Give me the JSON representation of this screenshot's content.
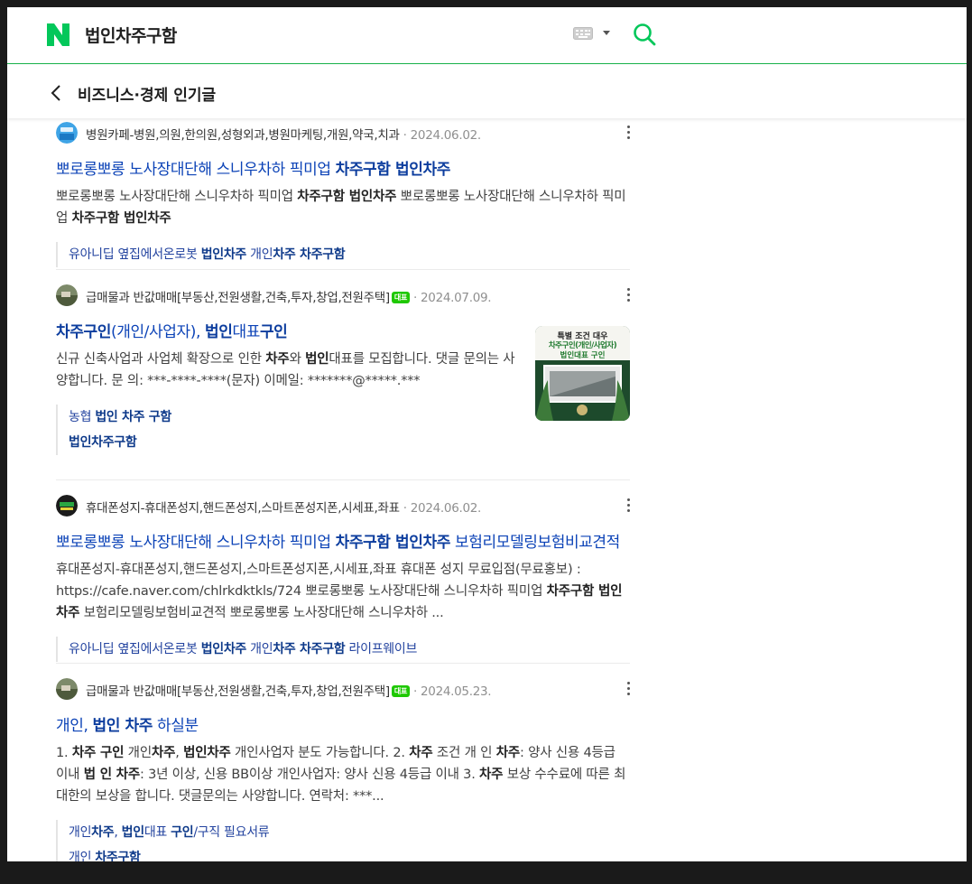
{
  "header": {
    "query": "법인차주구함",
    "section_title": "비즈니스·경제 인기글"
  },
  "colors": {
    "brand": "#03c75a",
    "link": "#0c43b7",
    "badge": "#1ec800"
  },
  "results": [
    {
      "source": "병원카페-병원,의원,한의원,성형외과,병원마케팅,개원,약국,치과",
      "date": "2024.06.02.",
      "title_parts": [
        "뽀로롱뽀롱 노사장대단해 스니우차하 픽미업 ",
        "차주구함 법인차주",
        ""
      ],
      "desc_html": "뽀로롱뽀롱 노사장대단해 스니우차하 픽미업 <b>차주구함 법인차주</b> 뽀로롱뽀롱 노사장대단해 스니우차하 픽미업 <b>차주구함 법인차주</b>",
      "tags_html": [
        "유아니딥 옆집에서온로봇 <b>법인차주</b> 개인<b>차주 차주구함</b>"
      ]
    },
    {
      "source": "급매물과 반값매매[부동산,전원생활,건축,투자,창업,전원주택]",
      "badge": "대표",
      "date": "2024.07.09.",
      "title_html": "<b>차주구인</b>(개인/사업자), <b>법인</b>대표<b>구인</b>",
      "desc_html": "신규 신축사업과 사업체 확장으로 인한 <b>차주</b>와 <b>법인</b>대표를 모집합니다. 댓글 문의는 사양합니다. 문 의: ***-****-****(문자) 이메일: *******@*****.***",
      "tags_html": [
        "농협 <b>법인 차주 구함</b>",
        "<b>법인차주구함</b>"
      ],
      "thumb_text": [
        "특별 조건 대우",
        "차주구인(개인/사업자)",
        "법인대표 구인"
      ]
    },
    {
      "source": "휴대폰성지-휴대폰성지,핸드폰성지,스마트폰성지폰,시세표,좌표",
      "date": "2024.06.02.",
      "title_html": "뽀로롱뽀롱 노사장대단해 스니우차하 픽미업 <b>차주구함 법인차주</b> 보험리모델링보험비교견적",
      "desc_html": "휴대폰성지-휴대폰성지,핸드폰성지,스마트폰성지폰,시세표,좌표 휴대폰 성지 무료입점(무료홍보) : https://cafe.naver.com/chlrkdktkls/724 뽀로롱뽀롱 노사장대단해 스니우차하 픽미업 <b>차주구함 법인차주</b> 보험리모델링보험비교견적 뽀로롱뽀롱 노사장대단해 스니우차하 ...",
      "tags_html": [
        "유아니딥 옆집에서온로봇 <b>법인차주</b> 개인<b>차주 차주구함</b> 라이프웨이브"
      ]
    },
    {
      "source": "급매물과 반값매매[부동산,전원생활,건축,투자,창업,전원주택]",
      "badge": "대표",
      "date": "2024.05.23.",
      "title_html": "개인, <b>법인 차주</b> 하실분",
      "desc_html": "1. <b>차주 구인</b> 개인<b>차주</b>, <b>법인차주</b> 개인사업자 분도 가능합니다. 2. <b>차주</b> 조건 개 인 <b>차주</b>: 양사 신용 4등급 이내 <b>법 인 차주</b>: 3년 이상, 신용 BB이상 개인사업자: 양사 신용 4등급 이내 3. <b>차주</b> 보상 수수료에 따른 최대한의 보상을 합니다. 댓글문의는 사양합니다. 연락처: ***...",
      "tags_html": [
        "개인<b>차주</b>, <b>법인</b>대표 <b>구인</b>/구직 필요서류",
        "개인 <b>차주구함</b>"
      ]
    }
  ]
}
